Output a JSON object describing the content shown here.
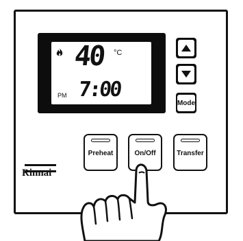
{
  "display": {
    "temperature": "40",
    "temperature_unit": "°C",
    "ampm": "PM",
    "time": "7:00",
    "flame_icon": "flame-icon"
  },
  "side_buttons": {
    "up_icon": "up-arrow-icon",
    "down_icon": "down-arrow-icon",
    "mode_label": "Mode"
  },
  "keys": {
    "preheat_label": "Preheat",
    "onoff_label": "On/Off",
    "transfer_label": "Transfer"
  },
  "brand": "Rinnai",
  "pointer": "pointing-hand-icon"
}
